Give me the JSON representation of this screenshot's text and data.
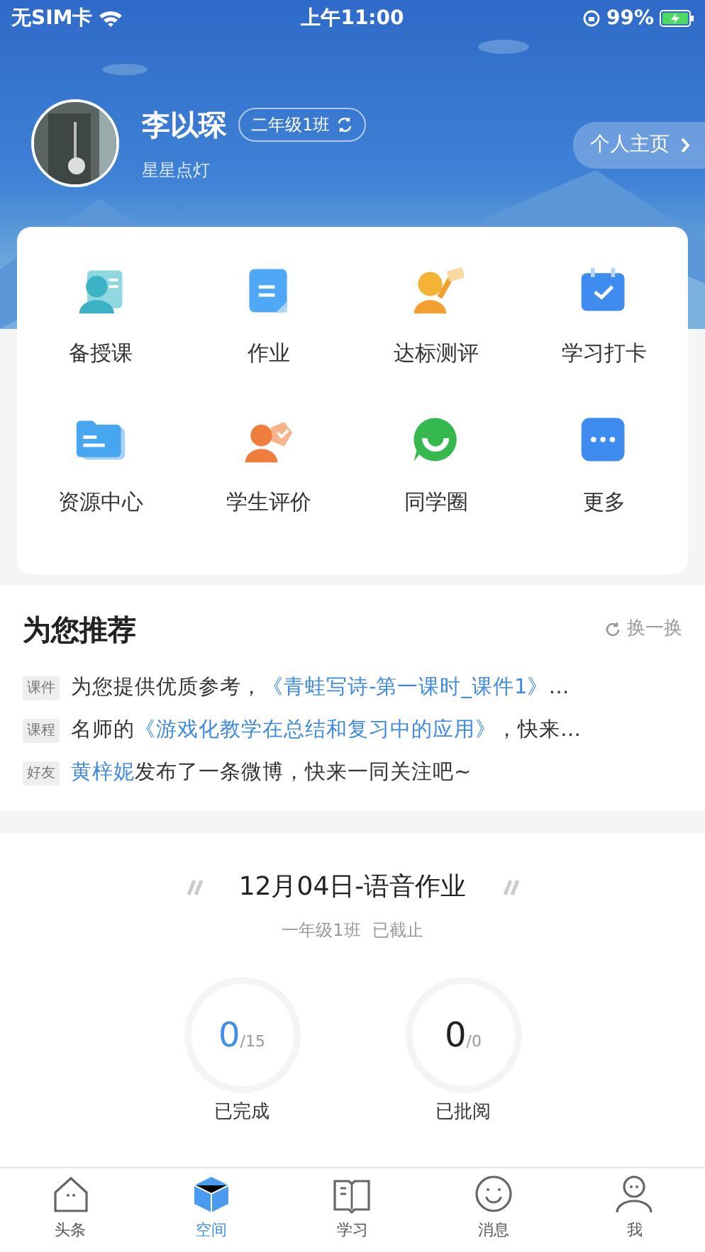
{
  "status_bar": {
    "carrier": "无SIM卡",
    "time": "上午11:00",
    "battery": "99%"
  },
  "profile": {
    "name": "李以琛",
    "class_badge": "二年级1班",
    "motto": "星星点灯",
    "homepage_button": "个人主页"
  },
  "features": [
    {
      "label": "备授课",
      "kind": "teacher"
    },
    {
      "label": "作业",
      "kind": "doc"
    },
    {
      "label": "达标测评",
      "kind": "eval"
    },
    {
      "label": "学习打卡",
      "kind": "calendar"
    },
    {
      "label": "资源中心",
      "kind": "folder"
    },
    {
      "label": "学生评价",
      "kind": "student"
    },
    {
      "label": "同学圈",
      "kind": "chat"
    },
    {
      "label": "更多",
      "kind": "more"
    }
  ],
  "recommend": {
    "title": "为您推荐",
    "refresh": "换一换",
    "items": [
      {
        "tag": "课件",
        "segments": [
          {
            "text": "为您提供优质参考，",
            "kind": "plain"
          },
          {
            "text": "《青蛙写诗-第一课时_课件1》",
            "kind": "link"
          },
          {
            "text": "…",
            "kind": "plain"
          }
        ]
      },
      {
        "tag": "课程",
        "segments": [
          {
            "text": "名师的",
            "kind": "plain"
          },
          {
            "text": "《游戏化教学在总结和复习中的应用》",
            "kind": "link"
          },
          {
            "text": "，快来…",
            "kind": "plain"
          }
        ]
      },
      {
        "tag": "好友",
        "segments": [
          {
            "text": "黄梓妮",
            "kind": "link"
          },
          {
            "text": "发布了一条微博，快来一同关注吧~",
            "kind": "plain"
          }
        ]
      }
    ]
  },
  "homework": {
    "title": "12月04日-语音作业",
    "class": "一年级1班",
    "status": "已截止",
    "stats": [
      {
        "value": "0",
        "total": "/15",
        "label": "已完成",
        "kind": "accent"
      },
      {
        "value": "0",
        "total": "/0",
        "label": "已批阅",
        "kind": "plain"
      }
    ]
  },
  "tab_bar": [
    {
      "label": "头条",
      "kind": "house",
      "selected": false
    },
    {
      "label": "空间",
      "kind": "cube",
      "selected": true
    },
    {
      "label": "学习",
      "kind": "book",
      "selected": false
    },
    {
      "label": "消息",
      "kind": "chat",
      "selected": false
    },
    {
      "label": "我",
      "kind": "person",
      "selected": false
    }
  ]
}
